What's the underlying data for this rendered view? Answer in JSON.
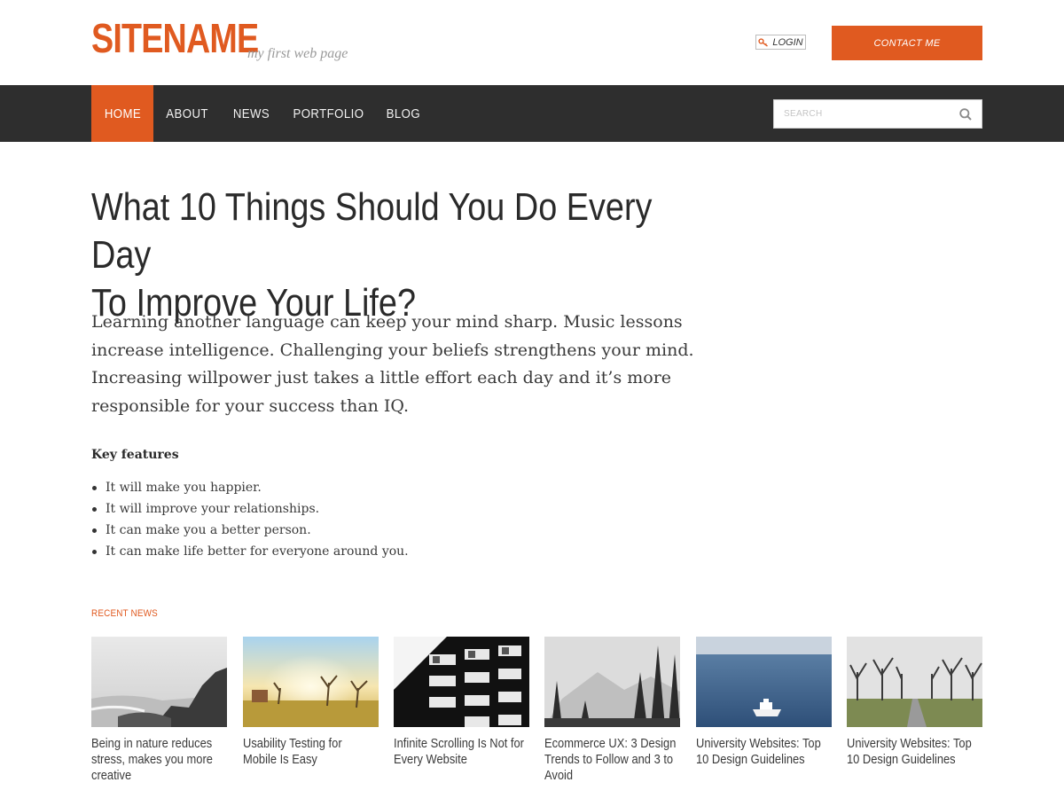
{
  "header": {
    "logo": "SITENAME",
    "tagline": "my first web page",
    "login_label": "LOGIN",
    "contact_label": "CONTACT ME"
  },
  "nav": {
    "items": [
      {
        "label": "HOME",
        "active": true
      },
      {
        "label": "ABOUT",
        "active": false
      },
      {
        "label": "NEWS",
        "active": false
      },
      {
        "label": "PORTFOLIO",
        "active": false
      },
      {
        "label": "BLOG",
        "active": false
      }
    ],
    "search_placeholder": "SEARCH"
  },
  "article": {
    "title_line1": "What 10 Things Should You Do Every Day",
    "title_line2": "To Improve Your Life?",
    "lead": "Learning another language can keep your mind sharp. Music lessons increase intelligence. Challenging your beliefs strengthens your mind. Increasing willpower just takes a little effort each day and it’s more responsible for your success than IQ.",
    "features_heading": "Key features",
    "features": [
      "It will make you happier.",
      "It will improve your relationships.",
      "It can make you a better person.",
      "It can make life better for everyone around you."
    ]
  },
  "recent_news": {
    "label": "RECENT NEWS",
    "items": [
      {
        "title": "Being in nature reduces stress, makes you more creative",
        "thumb": "misty-rocky-coast"
      },
      {
        "title": "Usability Testing for Mobile Is Easy",
        "thumb": "sunlit-trees-field"
      },
      {
        "title": "Infinite Scrolling Is Not for Every Website",
        "thumb": "building-facade-bw"
      },
      {
        "title": "Ecommerce UX: 3 Design Trends to Follow and 3 to Avoid",
        "thumb": "snowy-forest"
      },
      {
        "title": "University Websites: Top 10 Design Guidelines",
        "thumb": "boat-on-sea"
      },
      {
        "title": "University Websites: Top 10 Design Guidelines",
        "thumb": "tree-lined-path"
      }
    ]
  },
  "colors": {
    "accent": "#e05a20",
    "nav_bg": "#2e2e2e",
    "text": "#333333"
  }
}
